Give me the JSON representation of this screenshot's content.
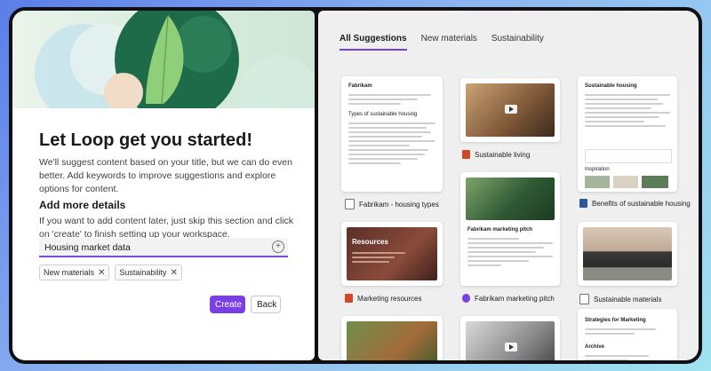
{
  "left": {
    "title": "Let Loop get you started!",
    "description": "We'll suggest content based on your title, but we can do even better. Add keywords to improve suggestions and explore options for content.",
    "details_heading": "Add more details",
    "details_text": "If you want to add content later, just skip this section and click on 'create' to finish setting up your workspace.",
    "input_value": "Housing market data",
    "chips": [
      "New materials",
      "Sustainability"
    ],
    "create_label": "Create",
    "back_label": "Back"
  },
  "tabs": [
    "All Suggestions",
    "New materials",
    "Sustainability"
  ],
  "cards": {
    "fabrikam_doc": {
      "heading": "Fabrikam",
      "subheading": "Types of sustainable housing"
    },
    "housing_doc": {
      "heading": "Sustainable housing",
      "subheading": "Inspiration"
    },
    "pitch_doc": {
      "heading": "Fabrikam marketing pitch"
    },
    "resources_slide": {
      "heading": "Resources"
    },
    "strategies_doc": {
      "heading": "Strategies for Marketing",
      "subheading": "Archive"
    }
  },
  "captions": {
    "c1": "Sustainable living",
    "c2": "Fabrikam - housing types",
    "c3": "Benefits of sustainable housing",
    "c4": "Marketing resources",
    "c5": "Fabrikam marketing pitch",
    "c6": "Sustainable materials"
  },
  "colors": {
    "accent": "#7a3fe4",
    "powerpoint": "#d24726",
    "word": "#2b579a",
    "loop": "#7a3fe4"
  }
}
